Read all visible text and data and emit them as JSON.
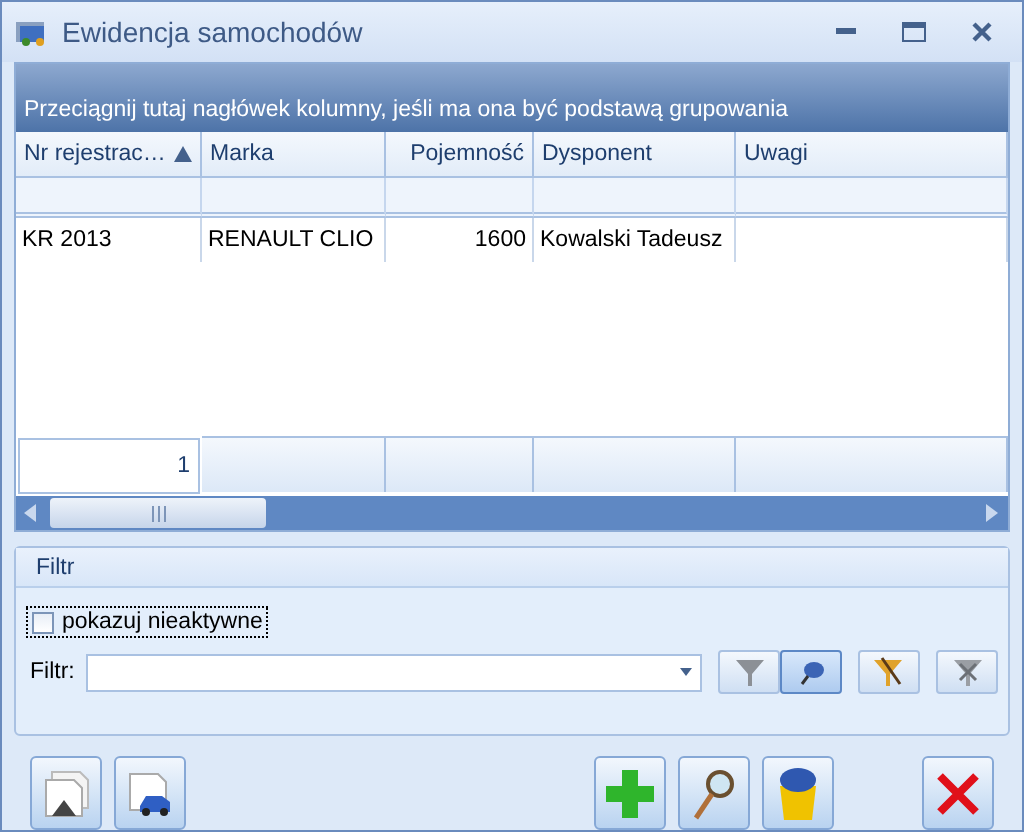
{
  "window": {
    "title": "Ewidencja samochodów"
  },
  "grid": {
    "group_hint": "Przeciągnij tutaj nagłówek kolumny, jeśli ma ona być podstawą grupowania",
    "columns": [
      {
        "label": "Nr rejestrac…",
        "sorted": true
      },
      {
        "label": "Marka",
        "sorted": false
      },
      {
        "label": "Pojemność",
        "sorted": false
      },
      {
        "label": "Dysponent",
        "sorted": false
      },
      {
        "label": "Uwagi",
        "sorted": false
      }
    ],
    "rows": [
      {
        "cells": [
          "KR 2013",
          "RENAULT CLIO",
          "1600",
          "Kowalski Tadeusz"
        ]
      }
    ],
    "row_count": "1"
  },
  "filter": {
    "title": "Filtr",
    "inactive_checkbox": {
      "label": "pokazuj nieaktywne",
      "checked": false,
      "focused": true
    },
    "field_label": "Filtr:"
  }
}
